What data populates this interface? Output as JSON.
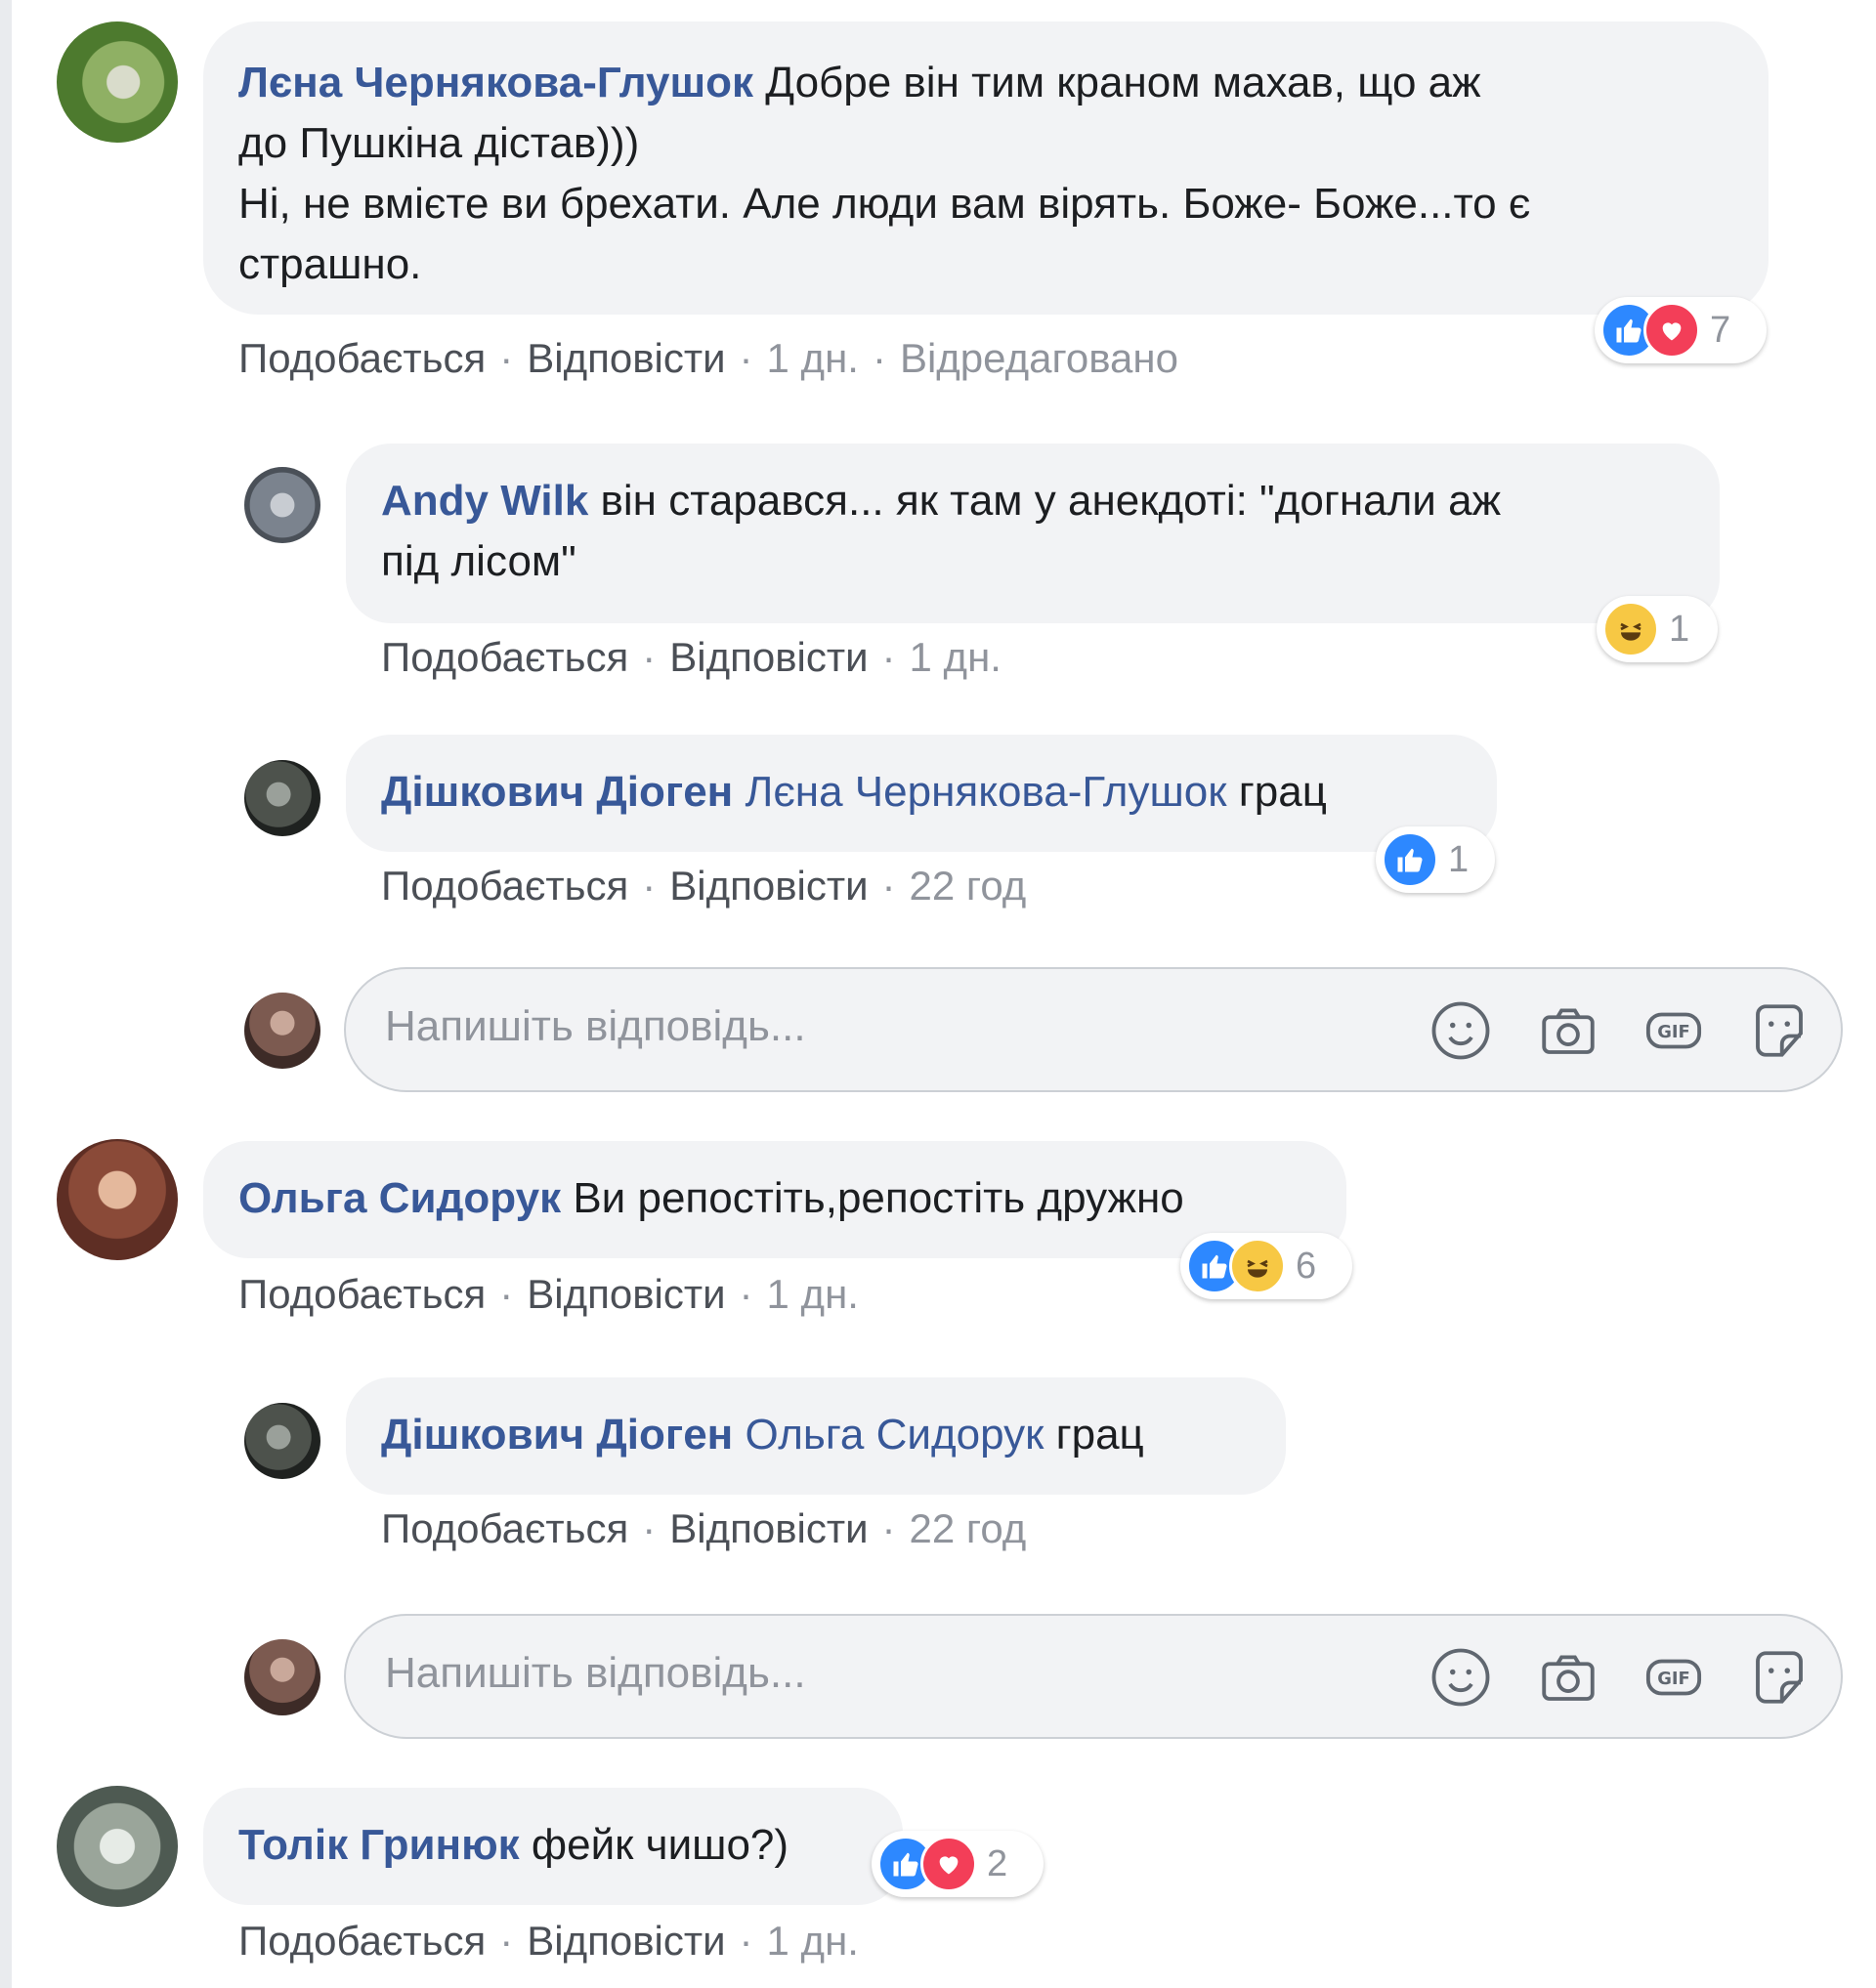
{
  "comments": [
    {
      "author": "Лєна Чернякова-Глушок",
      "text_line1": "Добре він тим краном махав, що аж",
      "text_line2": "до Пушкіна дістав)))",
      "text_line3": "Ні, не вмієте ви брехати. Але люди вам вірять. Боже- Боже...то є",
      "text_line4": "страшно.",
      "like_label": "Подобається",
      "reply_label": "Відповісти",
      "time": "1 дн.",
      "edited_label": "Відредаговано",
      "reaction_count": "7",
      "reactions": [
        "like-icon",
        "love-icon"
      ]
    },
    {
      "author": "Andy Wilk",
      "text_line1": "він старався... як там у анекдоті: \"догнали аж",
      "text_line2": "під лісом\"",
      "like_label": "Подобається",
      "reply_label": "Відповісти",
      "time": "1 дн.",
      "reaction_count": "1",
      "reactions": [
        "haha-icon"
      ]
    },
    {
      "author": "Дішкович Діоген",
      "mention": "Лєна Чернякова-Глушок",
      "text": "грац",
      "like_label": "Подобається",
      "reply_label": "Відповісти",
      "time": "22 год",
      "reaction_count": "1",
      "reactions": [
        "like-icon"
      ]
    },
    {
      "author": "Ольга Сидорук",
      "text": "Ви репостіть,репостіть дружно",
      "like_label": "Подобається",
      "reply_label": "Відповісти",
      "time": "1 дн.",
      "reaction_count": "6",
      "reactions": [
        "like-icon",
        "haha-icon"
      ]
    },
    {
      "author": "Дішкович Діоген",
      "mention": "Ольга Сидорук",
      "text": "грац",
      "like_label": "Подобається",
      "reply_label": "Відповісти",
      "time": "22 год"
    },
    {
      "author": "Толік Гринюк",
      "text": "фейк чишо?)",
      "like_label": "Подобається",
      "reply_label": "Відповісти",
      "time": "1 дн.",
      "reaction_count": "2",
      "reactions": [
        "like-icon",
        "love-icon"
      ]
    }
  ],
  "reply_boxes": [
    {
      "placeholder": "Напишіть відповідь...",
      "tools": [
        "emoji-icon",
        "camera-icon",
        "gif-icon",
        "sticker-icon"
      ]
    },
    {
      "placeholder": "Напишіть відповідь...",
      "tools": [
        "emoji-icon",
        "camera-icon",
        "gif-icon",
        "sticker-icon"
      ]
    }
  ],
  "colors": {
    "author": "#385898",
    "bubble": "#f2f3f5",
    "meta": "#90949c",
    "like": "#2d88ff",
    "love": "#f33e58",
    "haha": "#f7c844"
  }
}
